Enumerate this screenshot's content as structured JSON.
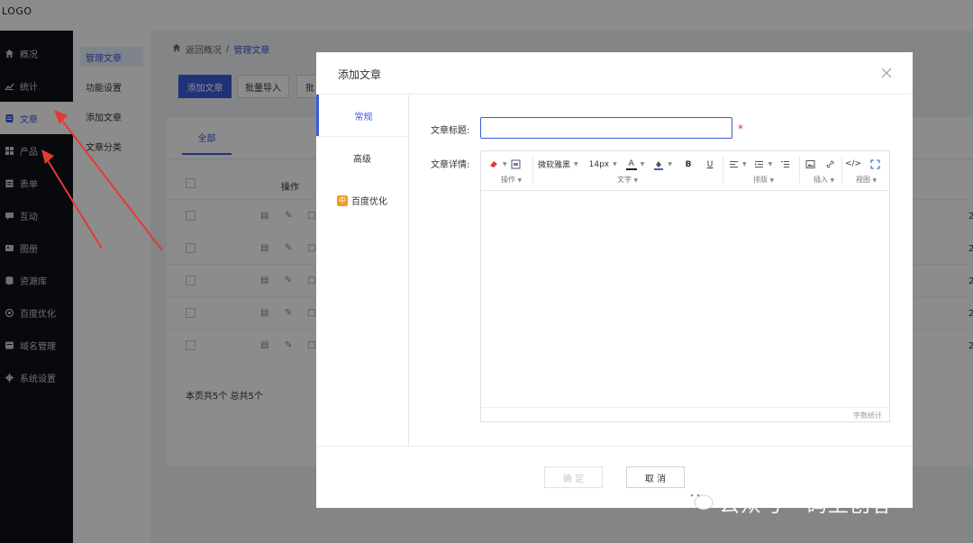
{
  "app": {
    "logo": "LOGO"
  },
  "sidebar": {
    "items": [
      {
        "label": "概况",
        "icon": "home-icon"
      },
      {
        "label": "统计",
        "icon": "chart-icon"
      },
      {
        "label": "文章",
        "icon": "document-icon",
        "active": true
      },
      {
        "label": "产品",
        "icon": "grid-icon"
      },
      {
        "label": "表单",
        "icon": "form-icon"
      },
      {
        "label": "互动",
        "icon": "chat-icon"
      },
      {
        "label": "图册",
        "icon": "album-icon"
      },
      {
        "label": "资源库",
        "icon": "database-icon"
      },
      {
        "label": "百度优化",
        "icon": "target-icon"
      },
      {
        "label": "域名管理",
        "icon": "domain-icon"
      },
      {
        "label": "系统设置",
        "icon": "gear-icon"
      }
    ]
  },
  "subnav": {
    "items": [
      {
        "label": "管理文章",
        "active": true
      },
      {
        "label": "功能设置"
      },
      {
        "label": "添加文章"
      },
      {
        "label": "文章分类"
      }
    ]
  },
  "breadcrumb": {
    "home": "返回概况",
    "separator": "/",
    "current": "管理文章"
  },
  "toolbar": {
    "add": "添加文章",
    "import": "批量导入",
    "partial": "批"
  },
  "list": {
    "tab_all": "全部",
    "col_action": "操作",
    "footer": "本页共5个  总共5个",
    "edge_values": [
      "2",
      "2",
      "2",
      "2",
      "2"
    ]
  },
  "modal": {
    "title": "添加文章",
    "tabs": [
      {
        "label": "常规",
        "active": true
      },
      {
        "label": "高级"
      },
      {
        "label": "百度优化",
        "badge": "中"
      }
    ],
    "fields": {
      "title_label": "文章标题:",
      "title_value": "",
      "required_mark": "*",
      "detail_label": "文章详情:"
    },
    "editor": {
      "font_family": "微软雅黑",
      "font_size": "14px",
      "groups": {
        "ops": "操作",
        "text": "文字",
        "layout": "排版",
        "insert": "插入",
        "view": "视图"
      },
      "bold": "B",
      "underline": "U",
      "color_glyph": "A",
      "code_glyph": "</>",
      "word_count": "字数统计"
    },
    "buttons": {
      "ok": "确 定",
      "cancel": "取 消"
    }
  },
  "watermark": {
    "text": "公众号 · 码上创客"
  },
  "colors": {
    "accent": "#3b5bdb",
    "sidebar": "#0e1116",
    "arrow": "#e53935",
    "badge": "#f59a23"
  }
}
